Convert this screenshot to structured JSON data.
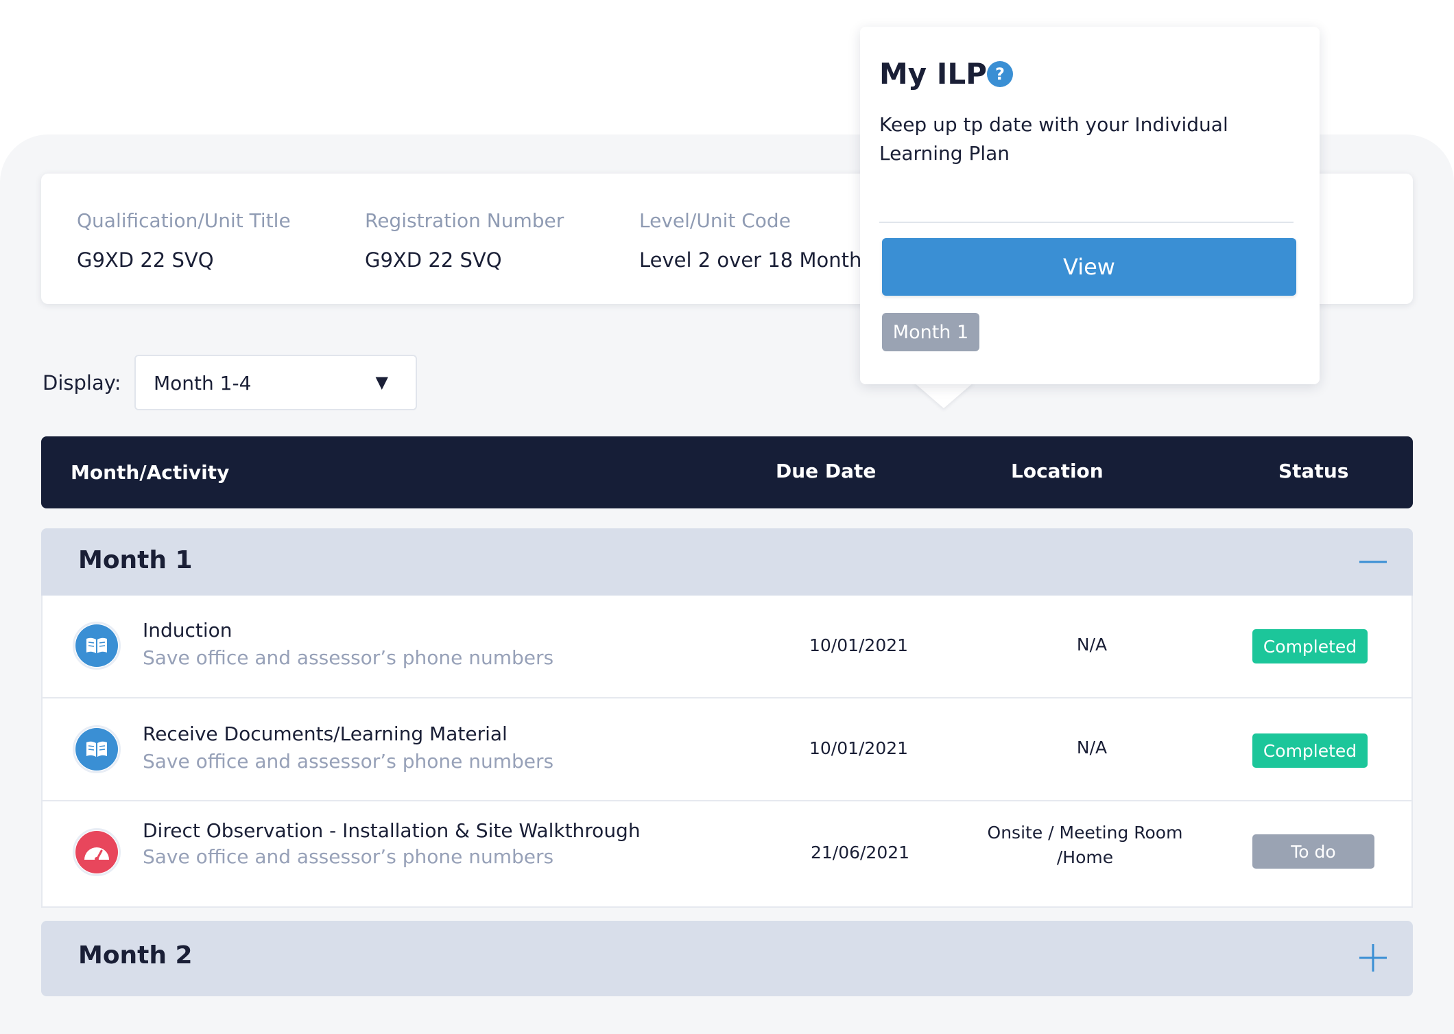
{
  "qualification": {
    "columns": [
      {
        "label": "Qualification/Unit Title",
        "value": "G9XD 22 SVQ"
      },
      {
        "label": "Registration Number",
        "value": "G9XD 22 SVQ"
      },
      {
        "label": "Level/Unit Code",
        "value": "Level 2 over 18 Months"
      }
    ]
  },
  "display": {
    "label": "Display:",
    "selected": "Month 1-4",
    "caret": "▼"
  },
  "table": {
    "headers": {
      "activity": "Month/Activity",
      "due_date": "Due Date",
      "location": "Location",
      "status": "Status"
    }
  },
  "months": [
    {
      "title": "Month 1",
      "expanded": true,
      "toggle_icon": "minus-icon",
      "activities": [
        {
          "icon": "book-icon",
          "icon_color": "#3a8fd4",
          "title": "Induction",
          "subtitle": "Save office and assessor’s phone numbers",
          "due_date": "10/01/2021",
          "location": "N/A",
          "status": "Completed"
        },
        {
          "icon": "book-icon",
          "icon_color": "#3a8fd4",
          "title": "Receive Documents/Learning Material",
          "subtitle": "Save office and assessor’s phone numbers",
          "due_date": "10/01/2021",
          "location": "N/A",
          "status": "Completed"
        },
        {
          "icon": "gauge-icon",
          "icon_color": "#e8465c",
          "title": "Direct Observation - Installation & Site Walkthrough",
          "subtitle": "Save office and assessor’s phone numbers",
          "due_date": "21/06/2021",
          "location_line1": "Onsite / Meeting Room",
          "location_line2": "/Home",
          "status": "To do"
        }
      ]
    },
    {
      "title": "Month 2",
      "expanded": false,
      "toggle_icon": "plus-icon"
    }
  ],
  "popover": {
    "title": "My ILP",
    "help_icon": "?",
    "text": "Keep up tp date with your Individual Learning Plan",
    "button": "View",
    "chip": "Month 1"
  },
  "colors": {
    "accent": "#3a8fd4",
    "header_bg": "#161e37",
    "completed": "#1cc69a",
    "todo": "#9aa3b3",
    "observation": "#e8465c",
    "month_header_bg": "#d8deea"
  }
}
